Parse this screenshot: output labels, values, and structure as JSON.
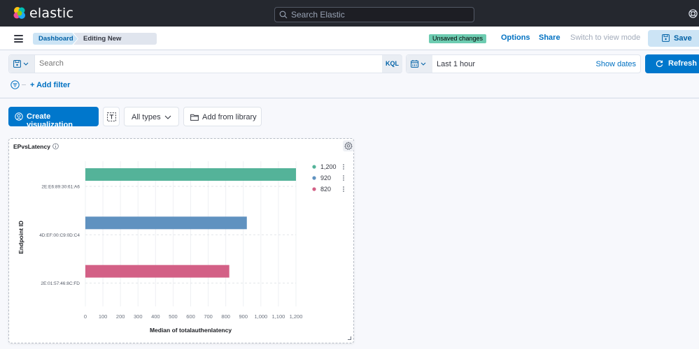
{
  "header": {
    "brand": "elastic",
    "search_placeholder": "Search Elastic"
  },
  "app_bar": {
    "breadcrumbs": [
      "Dashboard",
      "Editing New Dashboard"
    ],
    "unsaved_badge": "Unsaved changes",
    "links": {
      "options": "Options",
      "share": "Share",
      "switch_view": "Switch to view mode"
    },
    "save_label": "Save"
  },
  "query_bar": {
    "search_placeholder": "Search",
    "search_value": "",
    "language": "KQL",
    "time_range": "Last 1 hour",
    "show_dates": "Show dates",
    "refresh_label": "Refresh",
    "add_filter": "+ Add filter"
  },
  "toolbar": {
    "create_visualization": "Create visualization",
    "all_types": "All types",
    "add_from_library": "Add from library"
  },
  "panel": {
    "title": "EPvsLatency"
  },
  "chart_data": {
    "type": "bar",
    "orientation": "horizontal",
    "title": "EPvsLatency",
    "xlabel": "Median of totalauthenlatency",
    "ylabel": "Endpoint ID",
    "categories": [
      "2E:E6:89:30:61:A6",
      "4D:EF:00:C9:0D:C4",
      "2E:01:57:46:8C:FD"
    ],
    "values": [
      1200,
      920,
      820
    ],
    "colors": [
      "#54b399",
      "#6092c0",
      "#d36086"
    ],
    "xlim": [
      0,
      1200
    ],
    "xticks": [
      0,
      100,
      200,
      300,
      400,
      500,
      600,
      700,
      800,
      900,
      1000,
      1100,
      1200
    ],
    "xtick_labels": [
      "0",
      "100",
      "200",
      "300",
      "400",
      "500",
      "600",
      "700",
      "800",
      "900",
      "1,000",
      "1,100",
      "1,200"
    ],
    "grid": true,
    "legend_position": "top-right",
    "legend": [
      {
        "label": "1,200",
        "color": "#54b399"
      },
      {
        "label": "920",
        "color": "#6092c0"
      },
      {
        "label": "820",
        "color": "#d36086"
      }
    ]
  },
  "colors": {
    "header_bg": "#25282f",
    "primary": "#0077cc",
    "link": "#0071c2",
    "badge_success": "#6dccb1"
  }
}
